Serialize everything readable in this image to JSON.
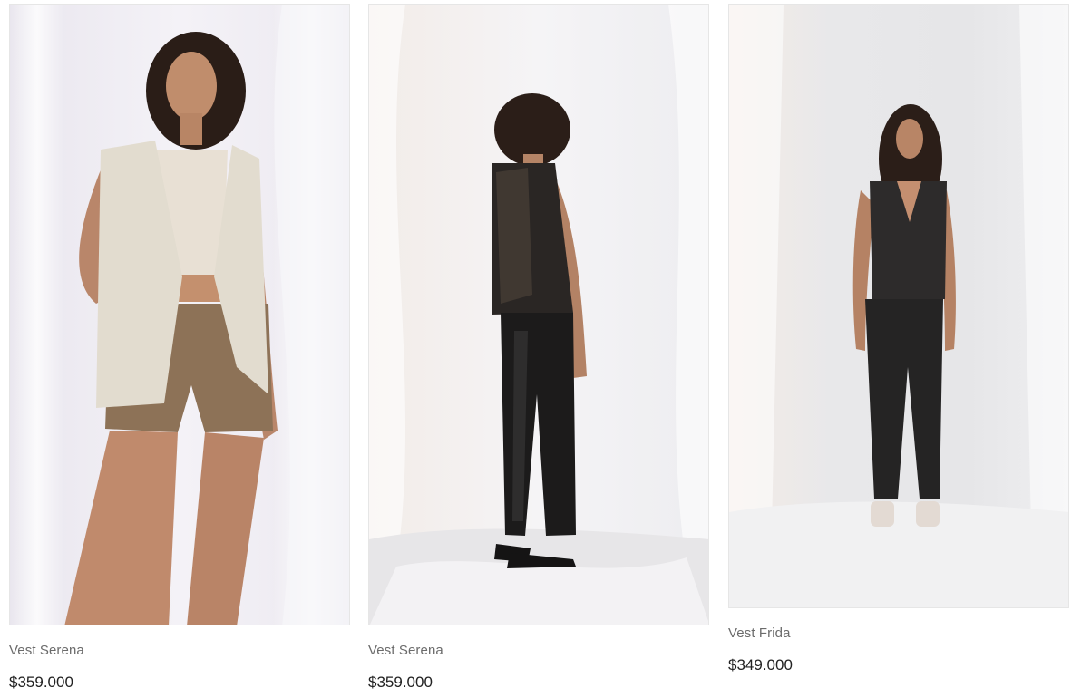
{
  "products": [
    {
      "name": "Vest Serena",
      "price": "$359.000",
      "image_alt": "Model wearing cream sleeveless vest with cropped top and brown suede shorts"
    },
    {
      "name": "Vest Serena",
      "price": "$359.000",
      "image_alt": "Model seen from behind wearing black leather vest and black leather trousers"
    },
    {
      "name": "Vest Frida",
      "price": "$349.000",
      "image_alt": "Model wearing black sleeveless lapel vest and black trousers with white sandals"
    }
  ]
}
